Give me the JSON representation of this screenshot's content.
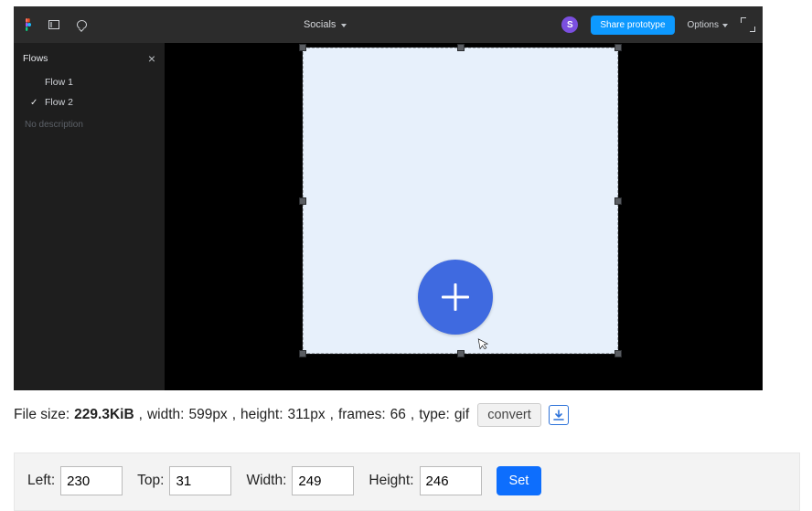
{
  "app": {
    "title": "Socials",
    "avatar_initial": "S",
    "share_label": "Share prototype",
    "options_label": "Options"
  },
  "flows": {
    "heading": "Flows",
    "items": [
      {
        "label": "Flow 1",
        "selected": false
      },
      {
        "label": "Flow 2",
        "selected": true
      }
    ],
    "no_description": "No description"
  },
  "info": {
    "filesize_label": "File size:",
    "filesize_value": "229.3KiB",
    "width_label": "width:",
    "width_value": "599px",
    "height_label": "height:",
    "height_value": "311px",
    "frames_label": "frames:",
    "frames_value": "66",
    "type_label": "type:",
    "type_value": "gif",
    "convert_label": "convert",
    "comma": ","
  },
  "crop": {
    "left_label": "Left:",
    "left_value": "230",
    "top_label": "Top:",
    "top_value": "31",
    "width_label": "Width:",
    "width_value": "249",
    "height_label": "Height:",
    "height_value": "246",
    "set_label": "Set"
  }
}
